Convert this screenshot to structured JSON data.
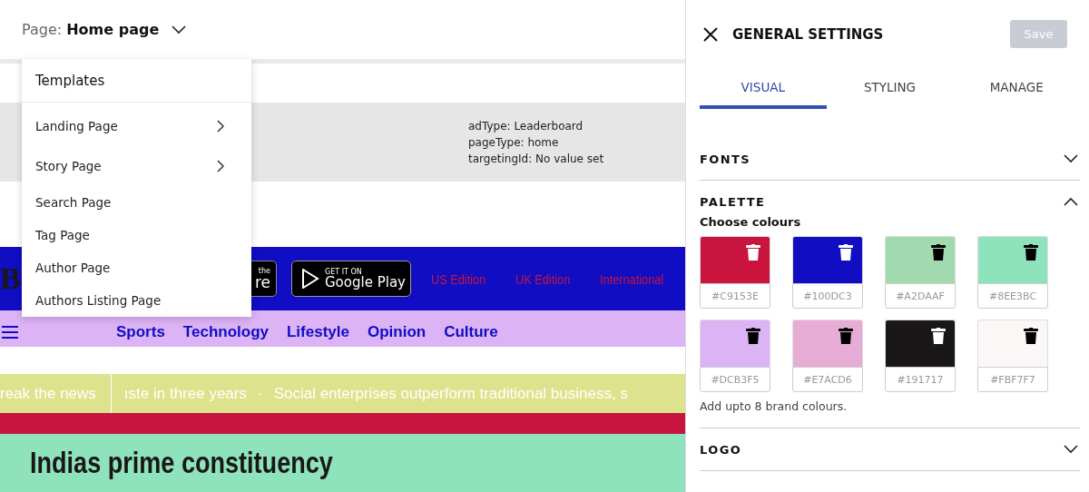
{
  "page_selector": {
    "label": "Page:",
    "value": "Home page"
  },
  "template_menu": {
    "title": "Templates",
    "items": [
      {
        "label": "Landing Page",
        "has_submenu": true
      },
      {
        "label": "Story Page",
        "has_submenu": true
      },
      {
        "label": "Search Page",
        "has_submenu": false
      },
      {
        "label": "Tag Page",
        "has_submenu": false
      },
      {
        "label": "Author Page",
        "has_submenu": false
      },
      {
        "label": "Authors Listing Page",
        "has_submenu": false
      }
    ]
  },
  "ad_slot": {
    "lines": [
      "adType: Leaderboard",
      "pageType: home",
      "targetingId: No value set"
    ]
  },
  "header_bar": {
    "logo": "B",
    "app_store": {
      "small": "the",
      "large": "re"
    },
    "google_play": {
      "small": "GET IT ON",
      "large": "Google Play"
    },
    "editions": [
      "US Edition",
      "UK Edition",
      "International"
    ]
  },
  "nav": {
    "items": [
      "Sports",
      "Technology",
      "Lifestyle",
      "Opinion",
      "Culture"
    ]
  },
  "ticker": [
    {
      "kind": "headline",
      "text": "reak the news"
    },
    {
      "kind": "rule"
    },
    {
      "kind": "headline",
      "text": "ıste in three years"
    },
    {
      "kind": "dot",
      "text": "·"
    },
    {
      "kind": "headline",
      "text": "Social enterprises outperform traditional business, s"
    }
  ],
  "headline": "Indias prime constituency",
  "settings": {
    "title": "GENERAL SETTINGS",
    "save": {
      "label": "Save",
      "disabled": true
    },
    "tabs": [
      {
        "label": "VISUAL",
        "selected": true
      },
      {
        "label": "STYLING",
        "selected": false
      },
      {
        "label": "MANAGE",
        "selected": false
      }
    ],
    "sections": [
      {
        "title": "FONTS",
        "expanded": false
      },
      {
        "title": "PALETTE",
        "expanded": true,
        "subtitle": "Choose colours",
        "colors": [
          {
            "color": "#c9153e",
            "hex": "#C9153E"
          },
          {
            "color": "#100dc3",
            "hex": "#100DC3"
          },
          {
            "color": "#a2daaf",
            "hex": "#A2DAAF"
          },
          {
            "color": "#8ee3bc",
            "hex": "#8EE3BC"
          },
          {
            "color": "#dcb3f5",
            "hex": "#DCB3F5"
          },
          {
            "color": "#e7acd6",
            "hex": "#E7ACD6"
          },
          {
            "color": "#191717",
            "hex": "#191717"
          },
          {
            "color": "#fbf7f7",
            "hex": "#FBF7F7"
          }
        ],
        "hint": "Add upto 8 brand colours."
      },
      {
        "title": "LOGO",
        "expanded": false
      }
    ]
  }
}
